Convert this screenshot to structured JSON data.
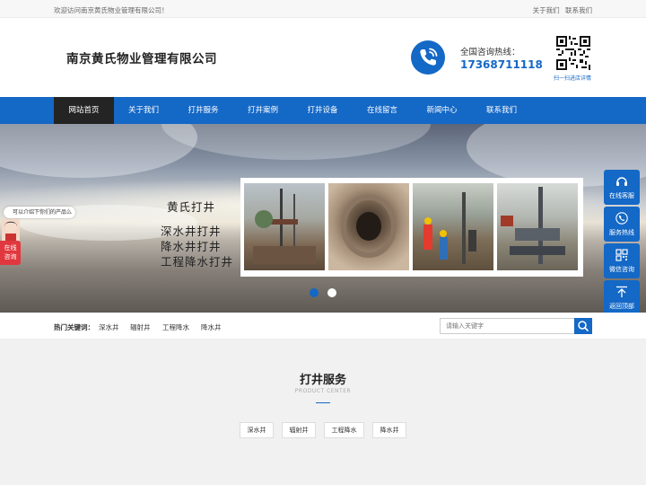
{
  "topbar": {
    "welcome": "欢迎访问南京黄氏物业管理有限公司！",
    "links": [
      "关于我们",
      "联系我们"
    ]
  },
  "header": {
    "company_name": "南京黄氏物业管理有限公司",
    "hotline_label": "全国咨询热线：",
    "hotline_number": "17368711118",
    "qr_caption": "扫一扫进店详情"
  },
  "nav": {
    "items": [
      "网站首页",
      "关于我们",
      "打井服务",
      "打井案例",
      "打井设备",
      "在线留言",
      "新闻中心",
      "联系我们"
    ],
    "active_index": 0
  },
  "banner": {
    "lines": [
      "黄氏打井",
      "深水井打井",
      "降水井打井",
      "工程降水打井"
    ],
    "slides_total": 2,
    "active_slide": 0
  },
  "chat": {
    "bubble": "可以介绍下你们的产品么",
    "button": [
      "在线",
      "咨询"
    ]
  },
  "float_bar": {
    "items": [
      {
        "label": "在线客服",
        "icon": "headset-icon"
      },
      {
        "label": "服务热线",
        "icon": "phone-icon"
      },
      {
        "label": "微信咨询",
        "icon": "qr-icon"
      },
      {
        "label": "返回顶部",
        "icon": "arrow-up-icon"
      }
    ]
  },
  "keywords": {
    "title": "热门关键词：",
    "items": [
      "深水井",
      "辐射井",
      "工程降水",
      "降水井"
    ]
  },
  "search": {
    "placeholder": "请输入关键字",
    "icon": "search-icon"
  },
  "services": {
    "title": "打井服务",
    "subtitle": "PRODUCT CENTER",
    "tabs": [
      "深水井",
      "辐射井",
      "工程降水",
      "降水井"
    ]
  },
  "colors": {
    "brand_blue": "#1468c6",
    "nav_active": "#242424",
    "chat_red": "#e0383e"
  }
}
